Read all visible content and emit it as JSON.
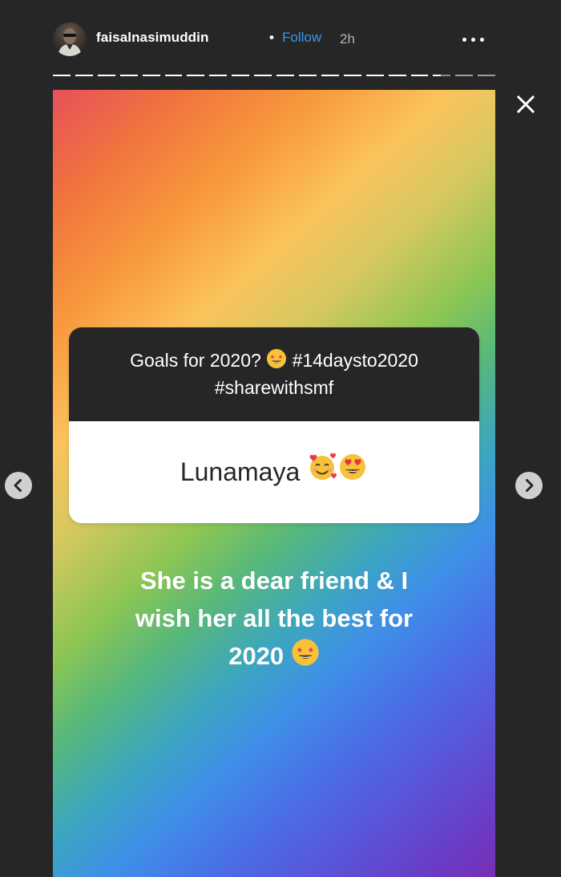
{
  "header": {
    "username": "faisalnasimuddin",
    "separator": "•",
    "follow_label": "Follow",
    "time": "2h"
  },
  "progress": {
    "segments": 20,
    "completed": 17,
    "active_fill": 0.45
  },
  "story": {
    "question": {
      "line1": "Goals for 2020?",
      "line1_tag": "#14daysto2020",
      "line2": "#sharewithsmf"
    },
    "answer": "Lunamaya",
    "caption_lines": [
      "She is a dear friend & I",
      "wish her all the best for",
      "2020"
    ]
  },
  "icons": {
    "more": "more-options-icon",
    "close": "close-icon",
    "prev": "chevron-left-icon",
    "next": "chevron-right-icon",
    "star_struck": "star-struck-emoji-icon",
    "hearts_face": "smiling-face-with-hearts-emoji-icon",
    "heart_eyes": "heart-eyes-emoji-icon"
  },
  "colors": {
    "background": "#262626",
    "follow": "#3897f0",
    "question_bg": "#262626",
    "answer_bg": "#ffffff"
  }
}
